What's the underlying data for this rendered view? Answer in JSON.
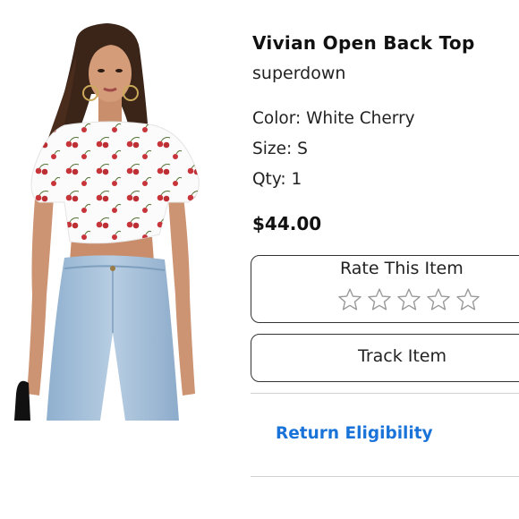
{
  "product": {
    "title": "Vivian Open Back Top",
    "brand": "superdown",
    "color": "Color: White Cherry",
    "size": "Size: S",
    "qty": "Qty: 1",
    "price": "$44.00"
  },
  "rating": {
    "label": "Rate This Item",
    "stars_total": 5,
    "stars_filled": 0
  },
  "actions": {
    "track_label": "Track Item",
    "return_label": "Return Eligibility"
  },
  "colors": {
    "link": "#1a73d9",
    "border": "#333333",
    "star_outline": "#9a9a9a"
  }
}
